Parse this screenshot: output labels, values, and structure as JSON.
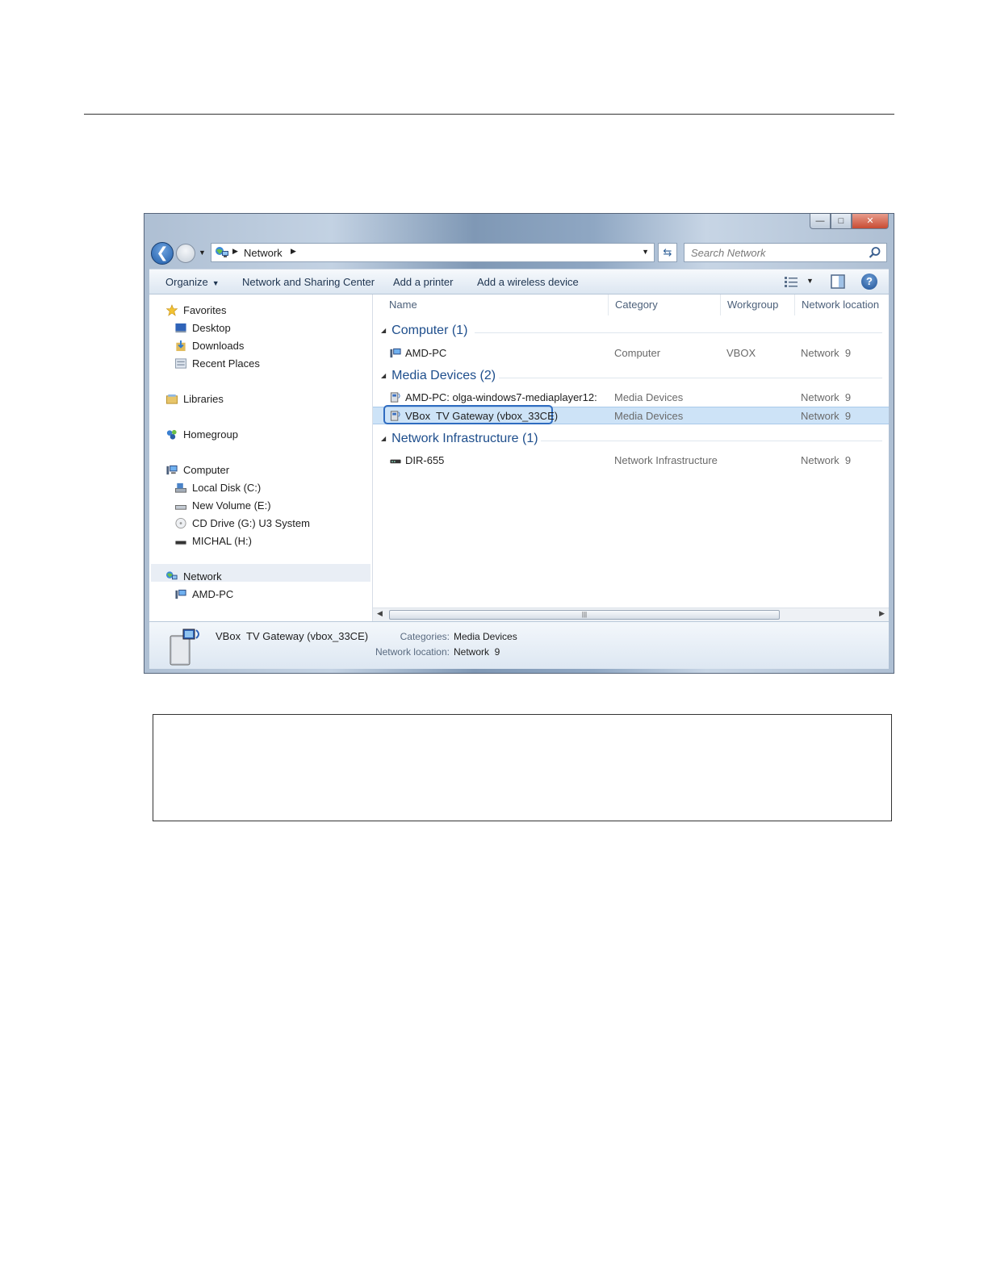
{
  "window": {
    "address": {
      "crumb": "Network"
    },
    "search": {
      "placeholder": "Search Network"
    },
    "toolbar": {
      "organize": "Organize",
      "network_sharing": "Network and Sharing Center",
      "add_printer": "Add a printer",
      "add_wireless": "Add a wireless device"
    },
    "nav": {
      "favorites": "Favorites",
      "desktop": "Desktop",
      "downloads": "Downloads",
      "recent": "Recent Places",
      "libraries": "Libraries",
      "homegroup": "Homegroup",
      "computer": "Computer",
      "local_disk": "Local Disk (C:)",
      "new_volume": "New Volume (E:)",
      "cd_drive": "CD Drive (G:) U3 System",
      "michal": "MICHAL (H:)",
      "network": "Network",
      "amd_pc": "AMD-PC"
    },
    "columns": {
      "name": "Name",
      "category": "Category",
      "workgroup": "Workgroup",
      "location": "Network location"
    },
    "groups": {
      "computer": "Computer (1)",
      "media": "Media Devices (2)",
      "infra": "Network Infrastructure (1)"
    },
    "rows": [
      {
        "name": "AMD-PC",
        "category": "Computer",
        "workgroup": "VBOX",
        "location": "Network  9"
      },
      {
        "name": "AMD-PC: olga-windows7-mediaplayer12:",
        "category": "Media Devices",
        "workgroup": "",
        "location": "Network  9"
      },
      {
        "name": "VBox  TV Gateway (vbox_33CE)",
        "category": "Media Devices",
        "workgroup": "",
        "location": "Network  9"
      },
      {
        "name": "DIR-655",
        "category": "Network Infrastructure",
        "workgroup": "",
        "location": "Network  9"
      }
    ],
    "details": {
      "name": "VBox  TV Gateway (vbox_33CE)",
      "categories_label": "Categories:",
      "categories_value": "Media Devices",
      "location_label": "Network location:",
      "location_value": "Network  9"
    },
    "colors": {
      "accent": "#1e4e8c",
      "selection": "#cde3f7",
      "highlight_border": "#2f6cc0"
    }
  }
}
